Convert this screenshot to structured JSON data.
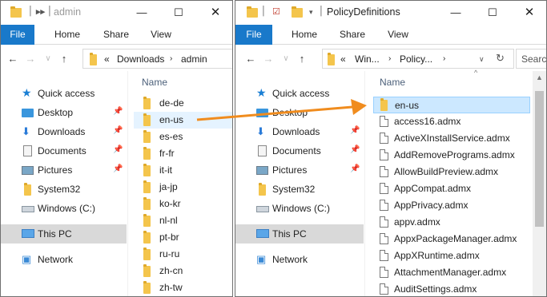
{
  "left": {
    "title": "admin",
    "tabs": [
      "File",
      "Home",
      "Share",
      "View"
    ],
    "path": [
      "Downloads",
      "admin"
    ],
    "crumb_prefix": "«",
    "nav_items": [
      {
        "label": "Quick access",
        "icon": "star-icon",
        "pinned": false,
        "selected": false
      },
      {
        "label": "Desktop",
        "icon": "desktop-icon",
        "pinned": true,
        "selected": false
      },
      {
        "label": "Downloads",
        "icon": "download-icon",
        "pinned": true,
        "selected": false
      },
      {
        "label": "Documents",
        "icon": "documents-icon",
        "pinned": true,
        "selected": false
      },
      {
        "label": "Pictures",
        "icon": "pictures-icon",
        "pinned": true,
        "selected": false
      },
      {
        "label": "System32",
        "icon": "folder-icon",
        "pinned": false,
        "selected": false
      },
      {
        "label": "Windows (C:)",
        "icon": "drive-icon",
        "pinned": false,
        "selected": false
      },
      {
        "label": "This PC",
        "icon": "pc-icon",
        "pinned": false,
        "selected": true
      },
      {
        "label": "Network",
        "icon": "network-icon",
        "pinned": false,
        "selected": false
      }
    ],
    "column_header": "Name",
    "items": [
      "de-de",
      "en-us",
      "es-es",
      "fr-fr",
      "it-it",
      "ja-jp",
      "ko-kr",
      "nl-nl",
      "pt-br",
      "ru-ru",
      "zh-cn",
      "zh-tw"
    ],
    "hover_index": 1
  },
  "right": {
    "title": "PolicyDefinitions",
    "tabs": [
      "File",
      "Home",
      "Share",
      "View"
    ],
    "path": [
      "Win...",
      "Policy..."
    ],
    "crumb_prefix": "«",
    "search_placeholder": "Search",
    "nav_items": [
      {
        "label": "Quick access",
        "icon": "star-icon",
        "pinned": false,
        "selected": false
      },
      {
        "label": "Desktop",
        "icon": "desktop-icon",
        "pinned": false,
        "selected": false
      },
      {
        "label": "Downloads",
        "icon": "download-icon",
        "pinned": true,
        "selected": false
      },
      {
        "label": "Documents",
        "icon": "documents-icon",
        "pinned": true,
        "selected": false
      },
      {
        "label": "Pictures",
        "icon": "pictures-icon",
        "pinned": true,
        "selected": false
      },
      {
        "label": "System32",
        "icon": "folder-icon",
        "pinned": false,
        "selected": false
      },
      {
        "label": "Windows (C:)",
        "icon": "drive-icon",
        "pinned": false,
        "selected": false
      },
      {
        "label": "This PC",
        "icon": "pc-icon",
        "pinned": false,
        "selected": true
      },
      {
        "label": "Network",
        "icon": "network-icon",
        "pinned": false,
        "selected": false
      }
    ],
    "column_header": "Name",
    "items": [
      {
        "name": "en-us",
        "type": "folder",
        "selected": true
      },
      {
        "name": "access16.admx",
        "type": "file",
        "selected": false
      },
      {
        "name": "ActiveXInstallService.admx",
        "type": "file",
        "selected": false
      },
      {
        "name": "AddRemovePrograms.admx",
        "type": "file",
        "selected": false
      },
      {
        "name": "AllowBuildPreview.admx",
        "type": "file",
        "selected": false
      },
      {
        "name": "AppCompat.admx",
        "type": "file",
        "selected": false
      },
      {
        "name": "AppPrivacy.admx",
        "type": "file",
        "selected": false
      },
      {
        "name": "appv.admx",
        "type": "file",
        "selected": false
      },
      {
        "name": "AppxPackageManager.admx",
        "type": "file",
        "selected": false
      },
      {
        "name": "AppXRuntime.admx",
        "type": "file",
        "selected": false
      },
      {
        "name": "AttachmentManager.admx",
        "type": "file",
        "selected": false
      },
      {
        "name": "AuditSettings.admx",
        "type": "file",
        "selected": false
      }
    ]
  },
  "colors": {
    "accent": "#1979ca",
    "arrow": "#f08c1e",
    "folder": "#f4c54c",
    "selected_bg": "#cce8ff"
  }
}
